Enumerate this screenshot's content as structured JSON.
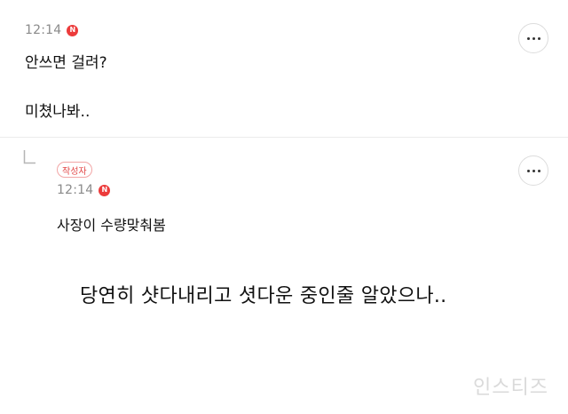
{
  "comments": [
    {
      "time": "12:14",
      "badge": "N",
      "lines": [
        "안쓰면 걸려?",
        "미쳤나봐.."
      ]
    },
    {
      "author_badge": "작성자",
      "time": "12:14",
      "badge": "N",
      "lines": [
        "사장이 수량맞춰봄",
        "당연히 샷다내리고 셧다운 중인줄 알았으나.."
      ]
    }
  ],
  "watermark": "인스티즈",
  "colors": {
    "new_badge": "#ec3b3b",
    "author_badge": "#e24848",
    "time_text": "#8a8a8a"
  }
}
